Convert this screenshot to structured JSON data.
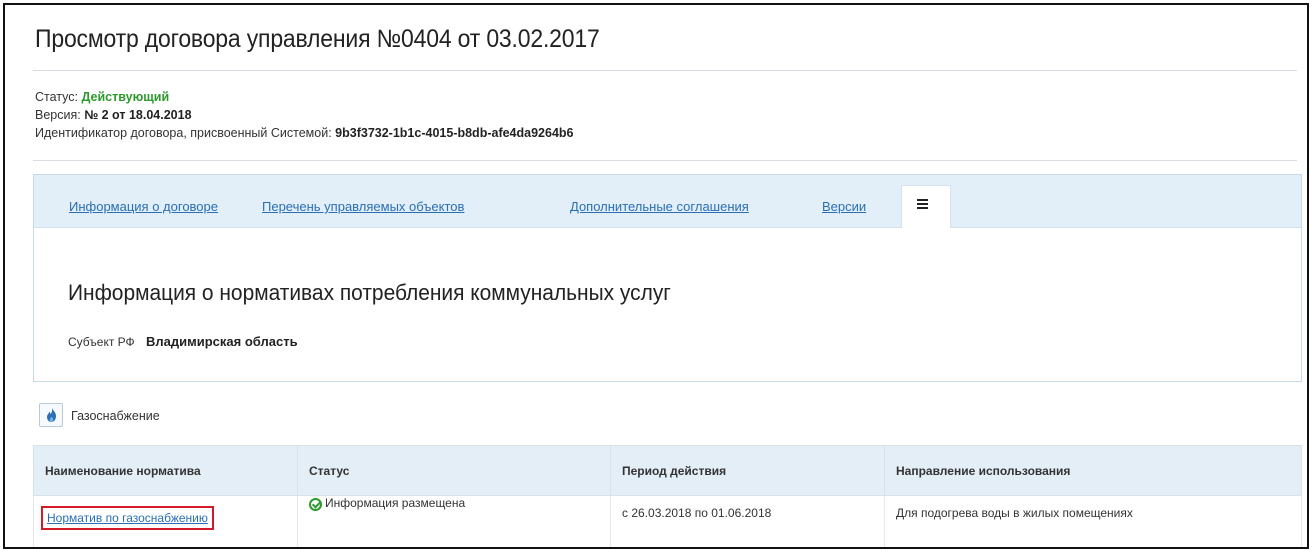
{
  "page_title": "Просмотр договора управления №0404 от 03.02.2017",
  "meta": {
    "status_label": "Статус:",
    "status_value": "Действующий",
    "version_label": "Версия:",
    "version_value": "№ 2 от 18.04.2018",
    "id_label": "Идентификатор договора, присвоенный Системой:",
    "id_value": "9b3f3732-1b1c-4015-b8db-afe4da9264b6"
  },
  "tabs": [
    {
      "label": "Информация о договоре"
    },
    {
      "label": "Перечень управляемых объектов"
    },
    {
      "label": "Дополнительные соглашения"
    },
    {
      "label": "Версии"
    }
  ],
  "active_tab_icon": "menu-list-icon",
  "section": {
    "title": "Информация о нормативах потребления коммунальных услуг",
    "subject_label": "Субъект РФ",
    "subject_value": "Владимирская область"
  },
  "service": {
    "icon": "gas-flame-icon",
    "label": "Газоснабжение"
  },
  "table": {
    "columns": [
      "Наименование норматива",
      "Статус",
      "Период действия",
      "Направление использования"
    ],
    "rows": [
      {
        "name": "Норматив по газоснабжению",
        "status": "Информация размещена",
        "period": "с 26.03.2018 по 01.06.2018",
        "direction": "Для подогрева воды в жилых помещениях"
      }
    ]
  },
  "colors": {
    "link": "#2a6fb5",
    "status_green": "#2e9a2e",
    "tabbar_bg": "#e2eef8",
    "highlight_border": "#d11b2b"
  }
}
